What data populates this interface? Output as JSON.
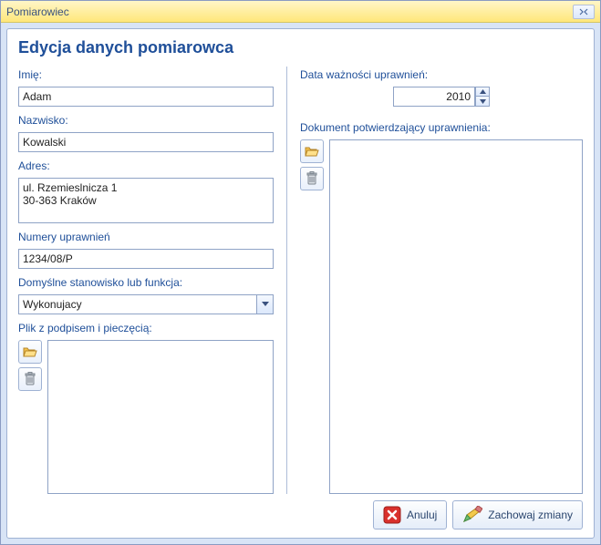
{
  "window": {
    "title": "Pomiarowiec"
  },
  "heading": "Edycja danych pomiarowca",
  "left": {
    "imie_label": "Imię:",
    "imie_value": "Adam",
    "nazwisko_label": "Nazwisko:",
    "nazwisko_value": "Kowalski",
    "adres_label": "Adres:",
    "adres_value": "ul. Rzemieslnicza 1\n30-363 Kraków",
    "numery_label": "Numery uprawnień",
    "numery_value": "1234/08/P",
    "stanowisko_label": "Domyślne stanowisko lub funkcja:",
    "stanowisko_value": "Wykonujacy",
    "plik_label": "Plik z podpisem i pieczęcią:"
  },
  "right": {
    "data_label": "Data ważności uprawnień:",
    "data_value": "2010",
    "dokument_label": "Dokument potwierdzający uprawnienia:"
  },
  "footer": {
    "cancel": "Anuluj",
    "save": "Zachowaj zmiany"
  },
  "colors": {
    "label": "#1f4f99"
  }
}
